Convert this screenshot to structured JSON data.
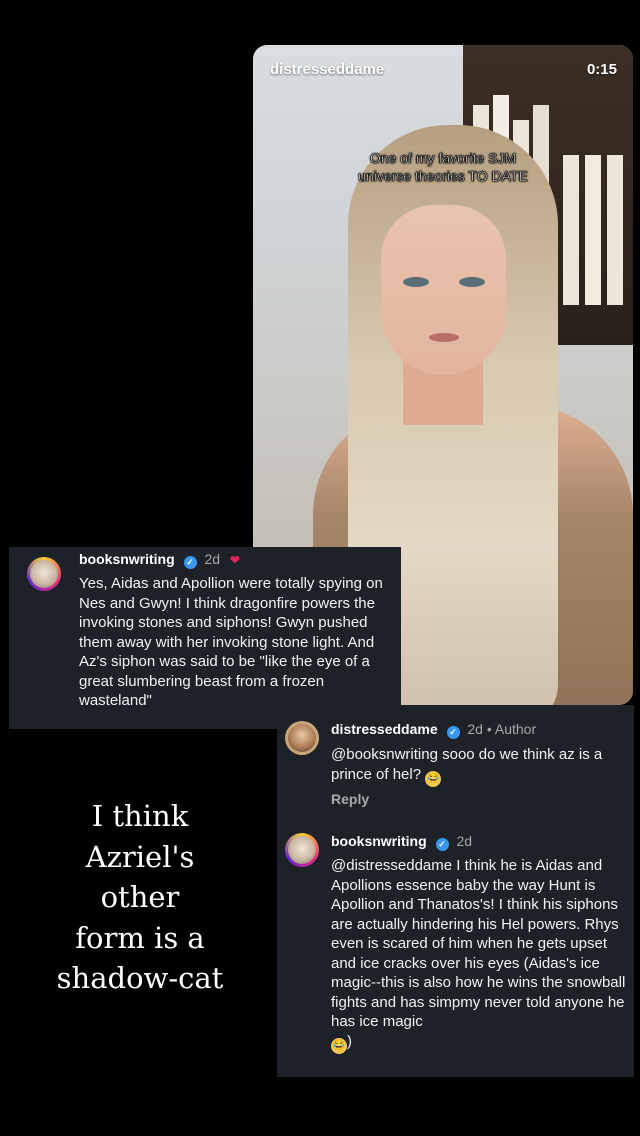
{
  "video": {
    "username": "distresseddame",
    "timestamp": "0:15",
    "caption_line1": "One of my favorite SJM",
    "caption_line2": "universe theories TO DATE"
  },
  "comment1": {
    "username": "booksnwriting",
    "age": "2d",
    "text": "Yes, Aidas and Apollion were totally spying on Nes and Gwyn! I think dragonfire powers the invoking stones and siphons! Gwyn pushed them away with her invoking stone light. And Az's siphon was said to be \"like the eye of a great slumbering beast from a frozen wasteland\""
  },
  "comment2": {
    "username": "distresseddame",
    "meta": "2d • Author",
    "text": "@booksnwriting sooo do we think az is a prince of hel?",
    "reply_label": "Reply"
  },
  "comment3": {
    "username": "booksnwriting",
    "age": "2d",
    "text": "@distresseddame I think he is Aidas and Apollions essence baby the way Hunt is Apollion and Thanatos's! I think his siphons are actually hindering his Hel powers. Rhys even is scared of him when he gets upset and ice cracks over his eyes (Aidas's ice magic--this is also how he wins the snowball fights and has simpmy never told anyone he has ice magic",
    "tail": ")"
  },
  "overlay_text": {
    "line1": "I think",
    "line2": "Azriel's",
    "line3": "other",
    "line4": "form is a",
    "line5": "shadow-cat"
  },
  "colors": {
    "background": "#000000",
    "card": "#1c2227",
    "verified": "#3897f0",
    "muted": "#a8a8a8"
  },
  "icons": [
    "verified-badge-icon",
    "heart-icon",
    "laughing-emoji-icon"
  ]
}
